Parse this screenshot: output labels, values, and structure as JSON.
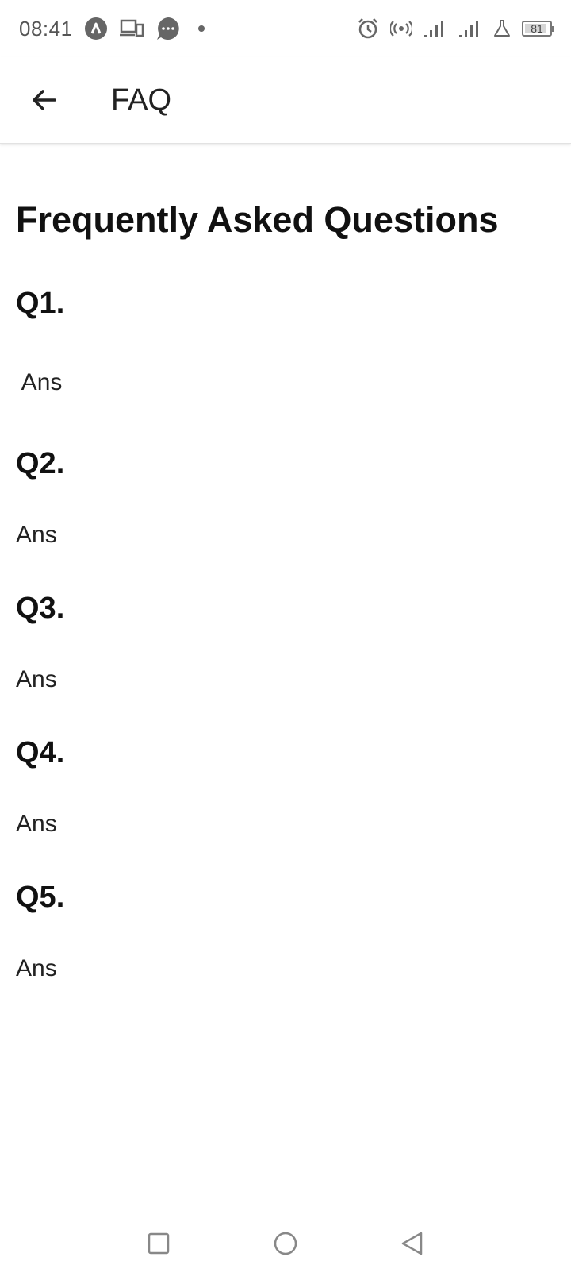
{
  "status_bar": {
    "time": "08:41",
    "battery": "81",
    "icons_left": [
      "app-a-icon",
      "devices-icon",
      "chat-bubble-icon",
      "notification-dot"
    ],
    "icons_right": [
      "alarm-icon",
      "hotspot-icon",
      "signal-icon",
      "signal-icon",
      "lab-icon",
      "battery-icon"
    ]
  },
  "appbar": {
    "title": "FAQ",
    "back_icon": "arrow-left-icon"
  },
  "page": {
    "title": "Frequently Asked Questions"
  },
  "faq": [
    {
      "question": "Q1.",
      "answer": " Ans"
    },
    {
      "question": "Q2.",
      "answer": "Ans"
    },
    {
      "question": "Q3.",
      "answer": "Ans"
    },
    {
      "question": "Q4.",
      "answer": "Ans"
    },
    {
      "question": "Q5.",
      "answer": "Ans"
    }
  ],
  "navbar": {
    "icons": [
      "recents-square-icon",
      "home-circle-icon",
      "back-triangle-icon"
    ]
  }
}
